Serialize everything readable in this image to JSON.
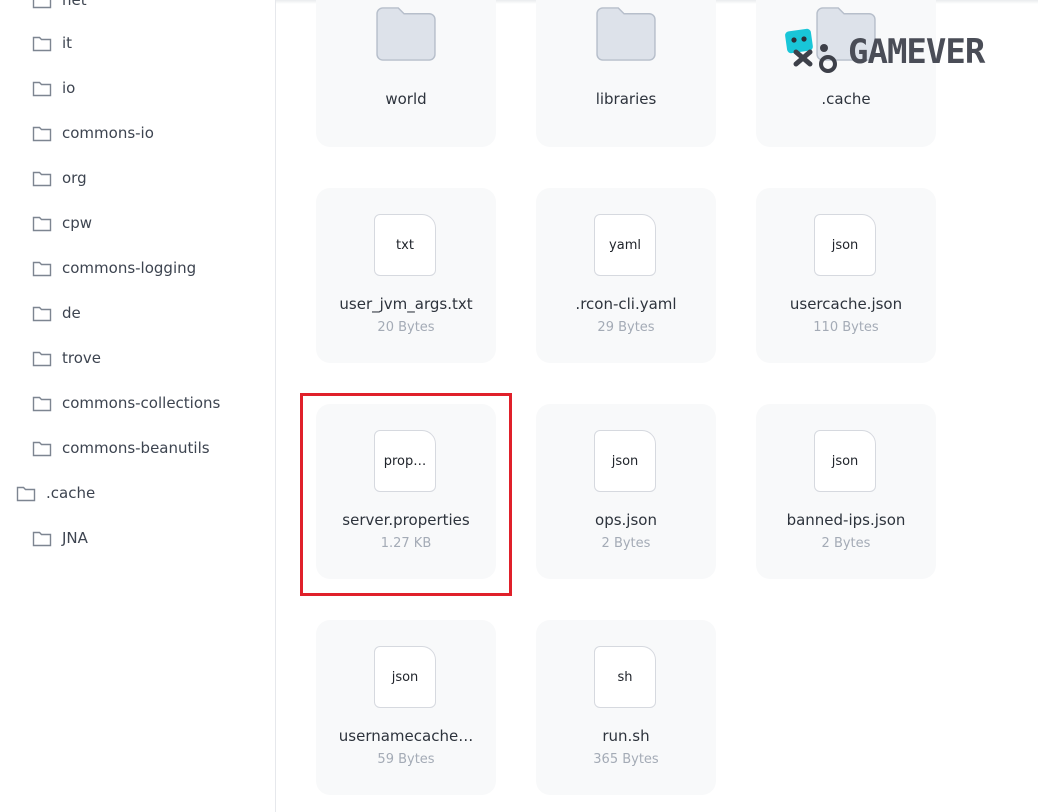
{
  "sidebar": {
    "items": [
      {
        "label": "net"
      },
      {
        "label": "it"
      },
      {
        "label": "io"
      },
      {
        "label": "commons-io"
      },
      {
        "label": "org"
      },
      {
        "label": "cpw"
      },
      {
        "label": "commons-logging"
      },
      {
        "label": "de"
      },
      {
        "label": "trove"
      },
      {
        "label": "commons-collections"
      },
      {
        "label": "commons-beanutils"
      },
      {
        "label": ".cache"
      },
      {
        "label": "JNA"
      }
    ]
  },
  "files": {
    "folders": [
      {
        "name": "world"
      },
      {
        "name": "libraries"
      },
      {
        "name": ".cache"
      }
    ],
    "items": [
      {
        "ext": "txt",
        "name": "user_jvm_args.txt",
        "size": "20 Bytes"
      },
      {
        "ext": "yaml",
        "name": ".rcon-cli.yaml",
        "size": "29 Bytes"
      },
      {
        "ext": "json",
        "name": "usercache.json",
        "size": "110 Bytes"
      },
      {
        "ext": "prop…",
        "name": "server.properties",
        "size": "1.27 KB"
      },
      {
        "ext": "json",
        "name": "ops.json",
        "size": "2 Bytes"
      },
      {
        "ext": "json",
        "name": "banned-ips.json",
        "size": "2 Bytes"
      },
      {
        "ext": "json",
        "name": "usernamecache…",
        "size": "59 Bytes"
      },
      {
        "ext": "sh",
        "name": "run.sh",
        "size": "365 Bytes"
      }
    ]
  },
  "logo": {
    "text": "GAMEVER"
  },
  "colors": {
    "highlight": "#e0202a",
    "card_bg": "#f8f9fa",
    "folder": "#dde2ea",
    "folder_border": "#b7bfcb"
  }
}
